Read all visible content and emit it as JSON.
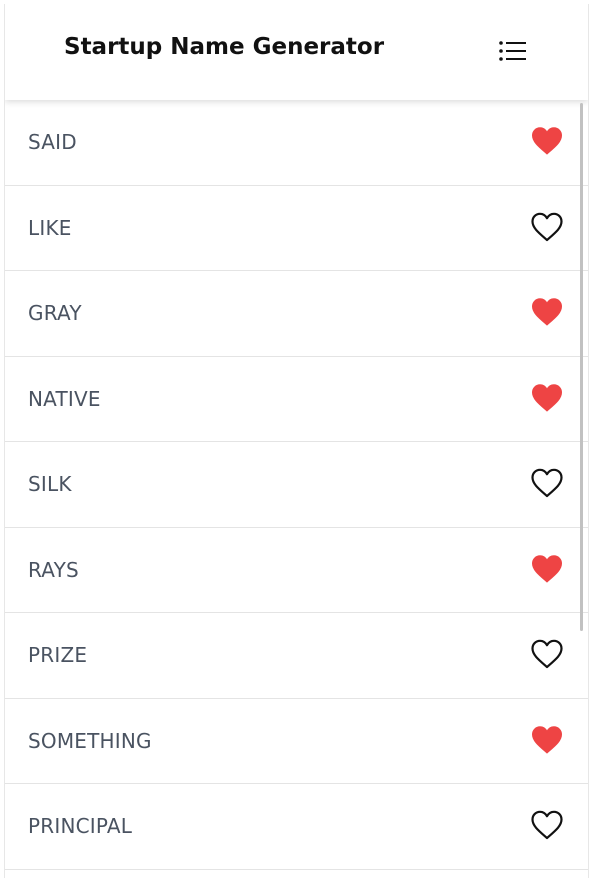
{
  "app": {
    "title": "Startup Name Generator",
    "menu_icon": "list-icon"
  },
  "colors": {
    "heart_filled": "#ee4444",
    "heart_outline": "#111111",
    "label": "#4a5361"
  },
  "items": [
    {
      "label": "SAID",
      "favorited": true
    },
    {
      "label": "LIKE",
      "favorited": false
    },
    {
      "label": "GRAY",
      "favorited": true
    },
    {
      "label": "NATIVE",
      "favorited": true
    },
    {
      "label": "SILK",
      "favorited": false
    },
    {
      "label": "RAYS",
      "favorited": true
    },
    {
      "label": "PRIZE",
      "favorited": false
    },
    {
      "label": "SOMETHING",
      "favorited": true
    },
    {
      "label": "PRINCIPAL",
      "favorited": false
    }
  ]
}
